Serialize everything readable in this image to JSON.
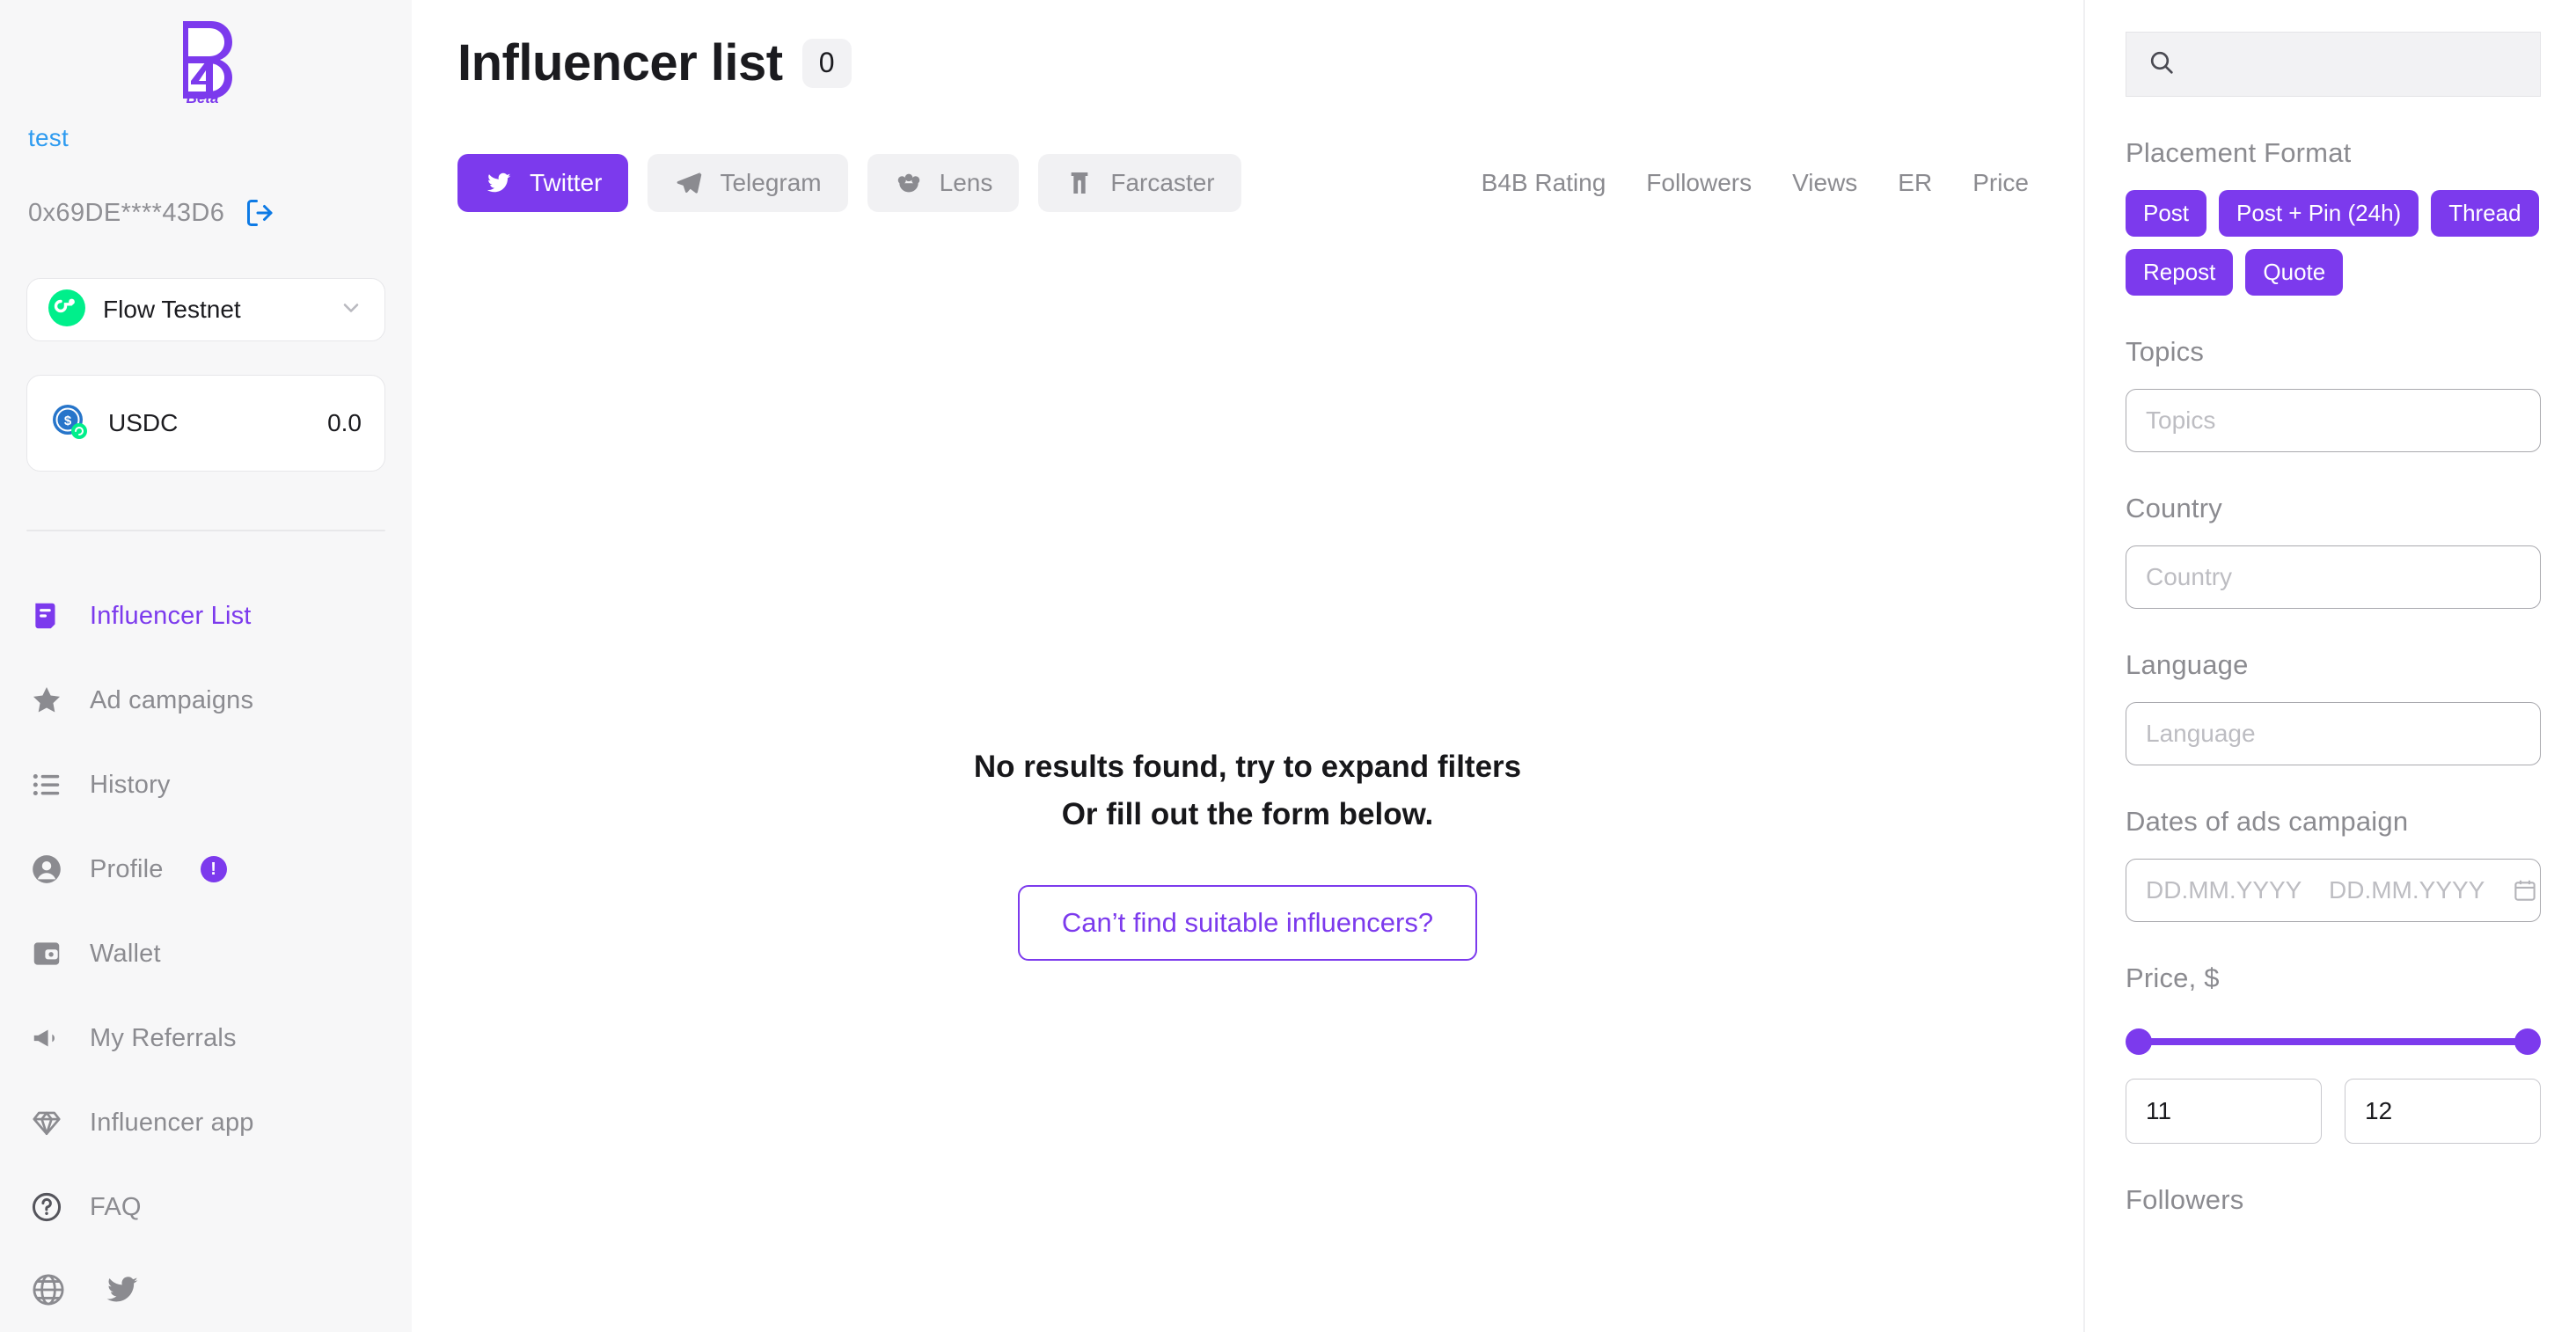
{
  "brand": {
    "logo_text": "B4",
    "logo_sub": "Beta"
  },
  "account": {
    "username": "test",
    "address": "0x69DE****43D6",
    "logout_icon": "logout-icon",
    "network": {
      "name": "Flow Testnet",
      "icon": "flow-logo-icon",
      "chevron": "chevron-down-icon"
    },
    "token": {
      "symbol": "USDC",
      "balance": "0.0",
      "icon": "usdc-token-icon"
    }
  },
  "sidebar": {
    "items": [
      {
        "label": "Influencer List",
        "icon": "list-document-icon",
        "active": true,
        "badge": null
      },
      {
        "label": "Ad campaigns",
        "icon": "star-icon",
        "active": false,
        "badge": null
      },
      {
        "label": "History",
        "icon": "list-bullets-icon",
        "active": false,
        "badge": null
      },
      {
        "label": "Profile",
        "icon": "user-icon",
        "active": false,
        "badge": "!"
      },
      {
        "label": "Wallet",
        "icon": "wallet-icon",
        "active": false,
        "badge": null
      },
      {
        "label": "My Referrals",
        "icon": "megaphone-icon",
        "active": false,
        "badge": null
      },
      {
        "label": "Influencer app",
        "icon": "diamond-icon",
        "active": false,
        "badge": null
      },
      {
        "label": "FAQ",
        "icon": "question-circle-icon",
        "active": false,
        "badge": null
      }
    ],
    "socials": [
      {
        "icon": "globe-icon"
      },
      {
        "icon": "twitter-bird-icon"
      }
    ]
  },
  "main": {
    "title": "Influencer list",
    "count": "0",
    "platform_tabs": [
      {
        "label": "Twitter",
        "icon": "twitter-bird-icon",
        "active": true
      },
      {
        "label": "Telegram",
        "icon": "telegram-plane-icon",
        "active": false
      },
      {
        "label": "Lens",
        "icon": "lens-flower-icon",
        "active": false
      },
      {
        "label": "Farcaster",
        "icon": "farcaster-arch-icon",
        "active": false
      }
    ],
    "sort_columns": [
      "B4B Rating",
      "Followers",
      "Views",
      "ER",
      "Price"
    ],
    "empty_state": {
      "line1": "No results found, try to expand filters",
      "line2": "Or fill out the form below.",
      "cta": "Can’t find suitable influencers?"
    }
  },
  "filters": {
    "search": {
      "placeholder": "",
      "value": "",
      "icon": "search-icon"
    },
    "placement_format": {
      "label": "Placement Format",
      "options": [
        "Post",
        "Post + Pin (24h)",
        "Thread",
        "Repost",
        "Quote"
      ]
    },
    "topics": {
      "label": "Topics",
      "placeholder": "Topics",
      "value": ""
    },
    "country": {
      "label": "Country",
      "placeholder": "Country",
      "value": ""
    },
    "language": {
      "label": "Language",
      "placeholder": "Language",
      "value": ""
    },
    "dates": {
      "label": "Dates of ads campaign",
      "from_placeholder": "DD.MM.YYYY",
      "to_placeholder": "DD.MM.YYYY",
      "from_value": "",
      "to_value": "",
      "icon": "calendar-icon"
    },
    "price": {
      "label": "Price, $",
      "min": "11",
      "max": "12"
    },
    "followers": {
      "label": "Followers"
    }
  },
  "colors": {
    "accent": "#7C3AED",
    "link": "#2E9BF0",
    "muted": "#8B8B90",
    "sidebar_bg": "#F7F7F8"
  }
}
